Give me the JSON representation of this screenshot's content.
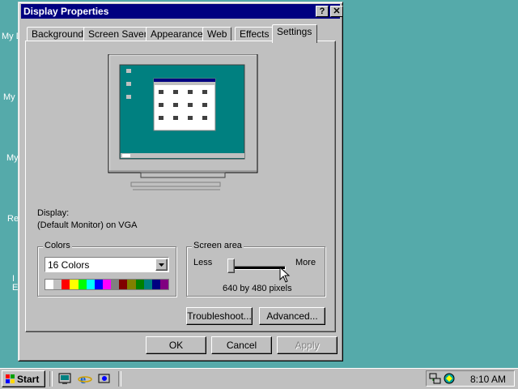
{
  "desktop": {
    "icons": [
      "My D",
      "My",
      "My",
      "Re",
      "I\nE"
    ]
  },
  "dialog": {
    "title": "Display Properties",
    "help_label": "?",
    "close_label": "✕",
    "tabs": [
      {
        "label": "Background",
        "active": false
      },
      {
        "label": "Screen Saver",
        "active": false
      },
      {
        "label": "Appearance",
        "active": false
      },
      {
        "label": "Web",
        "active": false
      },
      {
        "label": "Effects",
        "active": false
      },
      {
        "label": "Settings",
        "active": true
      }
    ],
    "display_label": "Display:",
    "display_value": "(Default Monitor) on VGA",
    "colors": {
      "group_label": "Colors",
      "selected": "16 Colors",
      "palette": [
        "#ffffff",
        "#c0c0c0",
        "#ff0000",
        "#ffff00",
        "#00ff00",
        "#00ffff",
        "#0000ff",
        "#ff00ff",
        "#808080",
        "#800000",
        "#808000",
        "#008000",
        "#008080",
        "#000080",
        "#800080"
      ]
    },
    "screen_area": {
      "group_label": "Screen area",
      "less_label": "Less",
      "more_label": "More",
      "resolution": "640 by 480 pixels",
      "slider_level": 0
    },
    "buttons": {
      "troubleshoot": "Troubleshoot...",
      "advanced": "Advanced...",
      "ok": "OK",
      "cancel": "Cancel",
      "apply": "Apply"
    }
  },
  "taskbar": {
    "start_label": "Start",
    "clock": "8:10 AM"
  }
}
